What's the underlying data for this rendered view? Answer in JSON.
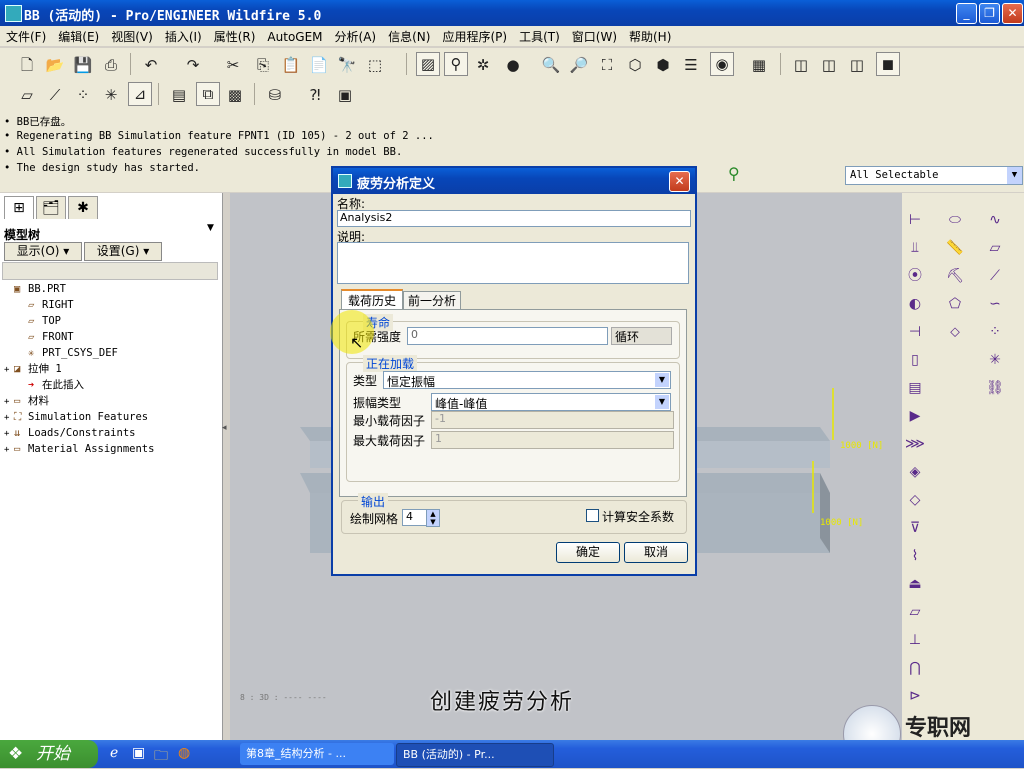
{
  "window": {
    "title": "BB (活动的) - Pro/ENGINEER Wildfire 5.0"
  },
  "menu": [
    "文件(F)",
    "编辑(E)",
    "视图(V)",
    "插入(I)",
    "属性(R)",
    "AutoGEM",
    "分析(A)",
    "信息(N)",
    "应用程序(P)",
    "工具(T)",
    "窗口(W)",
    "帮助(H)"
  ],
  "messages": [
    "BB已存盘。",
    "Regenerating BB Simulation feature  FPNT1 (ID 105) - 2 out of 2 ...",
    "All Simulation features regenerated successfully in model BB.",
    "The design study has started."
  ],
  "select_filter": "All Selectable",
  "model_tree": {
    "title": "模型树",
    "show_button": "显示(O) ▾",
    "settings_button": "设置(G) ▾",
    "items": [
      {
        "label": "BB.PRT",
        "icon": "part-icon",
        "expand": ""
      },
      {
        "label": "RIGHT",
        "icon": "datum-plane-icon",
        "expand": ""
      },
      {
        "label": "TOP",
        "icon": "datum-plane-icon",
        "expand": ""
      },
      {
        "label": "FRONT",
        "icon": "datum-plane-icon",
        "expand": ""
      },
      {
        "label": "PRT_CSYS_DEF",
        "icon": "csys-icon",
        "expand": ""
      },
      {
        "label": "拉伸 1",
        "icon": "extrude-icon",
        "expand": "+"
      },
      {
        "label": "在此插入",
        "icon": "insert-arrow-icon",
        "expand": ""
      },
      {
        "label": "材料",
        "icon": "material-icon",
        "expand": "+"
      },
      {
        "label": "Simulation Features",
        "icon": "simulation-icon",
        "expand": "+"
      },
      {
        "label": "Loads/Constraints",
        "icon": "loads-icon",
        "expand": "+"
      },
      {
        "label": "Material Assignments",
        "icon": "material-assign-icon",
        "expand": "+"
      }
    ]
  },
  "viewport": {
    "load_label_1": "1000 [N]",
    "load_label_2": "1000 [N]",
    "coord_text": "8 : 3D : ---- ----"
  },
  "dialog": {
    "title": "疲劳分析定义",
    "name_label": "名称:",
    "name_value": "Analysis2",
    "desc_label": "说明:",
    "desc_value": "",
    "tabs": [
      "载荷历史",
      "前一分析"
    ],
    "life_group": "寿命",
    "required_strength_label": "所需强度",
    "required_strength_value": "0",
    "cycle_label": "循环",
    "loading_group": "正在加载",
    "type_label": "类型",
    "type_value": "恒定振幅",
    "amplitude_label": "振幅类型",
    "amplitude_value": "峰值-峰值",
    "min_factor_label": "最小载荷因子",
    "min_factor_value": "-1",
    "max_factor_label": "最大载荷因子",
    "max_factor_value": "1",
    "output_group": "输出",
    "plot_grid_label": "绘制网格",
    "plot_grid_value": "4",
    "safety_label": "计算安全系数",
    "ok": "确定",
    "cancel": "取消"
  },
  "caption": "创建疲劳分析",
  "watermark": "专职网",
  "taskbar": {
    "start": "开始",
    "tasks": [
      "第8章_结构分析 - ...",
      "BB (活动的) - Pr..."
    ]
  },
  "colors": {
    "title_blue": "#0a3ea8",
    "accent_blue": "#0046d5",
    "load_yellow": "#e8e800"
  }
}
